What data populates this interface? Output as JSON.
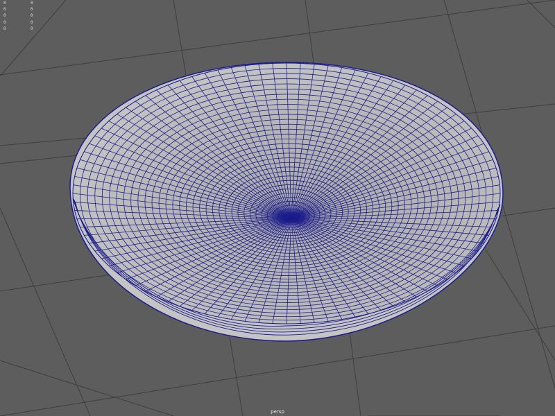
{
  "viewport": {
    "camera_name": "persp",
    "background": "#5d5d5d",
    "grid_color": "#3e3e3e",
    "wire_color": "#1c1c8c",
    "mesh_fill": "#aeaeae",
    "mesh_fill_dark": "#8a8a8a",
    "mesh_fill_light": "#c4c4c4"
  },
  "hud": {
    "rows": [
      [
        "0",
        "0"
      ],
      [
        "0",
        "0"
      ],
      [
        "0",
        "0"
      ],
      [
        "0",
        "0"
      ],
      [
        "0",
        "0"
      ]
    ]
  }
}
